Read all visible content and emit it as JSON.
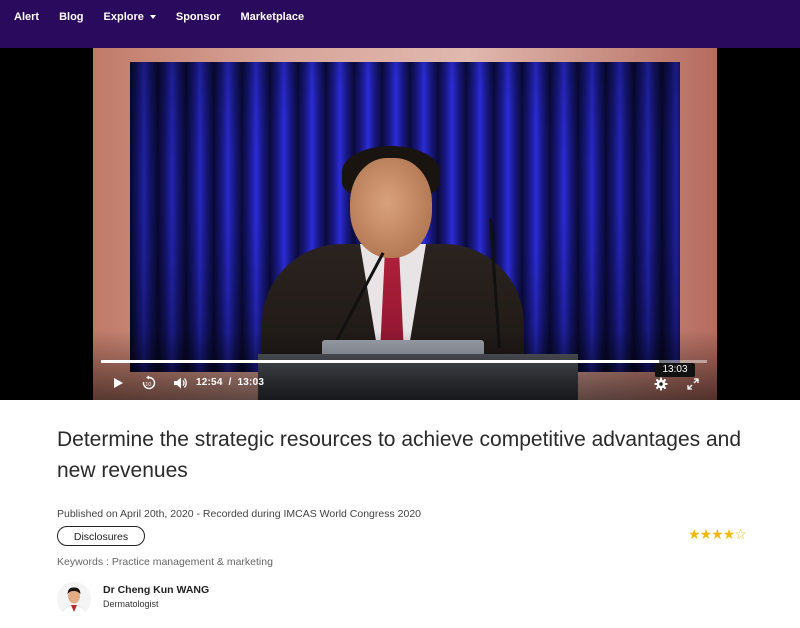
{
  "nav": {
    "items": [
      {
        "label": "Alert"
      },
      {
        "label": "Blog"
      },
      {
        "label": "Explore",
        "has_dropdown": true
      },
      {
        "label": "Sponsor"
      },
      {
        "label": "Marketplace"
      }
    ],
    "background": "#2a0a5c"
  },
  "video": {
    "current_time": "12:54",
    "separator": "/",
    "duration": "13:03",
    "hover_time": "13:03",
    "progress_fraction": 0.92,
    "icons": {
      "play": "play-icon",
      "rewind": "rewind-10-icon",
      "volume": "volume-icon",
      "settings": "gear-icon",
      "fullscreen": "fullscreen-icon"
    }
  },
  "talk": {
    "title": "Determine the strategic resources to achieve competitive advantages and new revenues",
    "published": "Published on April 20th, 2020 - Recorded during IMCAS World Congress 2020",
    "disclosures_label": "Disclosures",
    "keywords": "Keywords : Practice management & marketing",
    "rating": 4,
    "rating_max": 5,
    "star_color": "#f2b90c"
  },
  "author": {
    "name": "Dr Cheng Kun WANG",
    "role": "Dermatologist"
  }
}
